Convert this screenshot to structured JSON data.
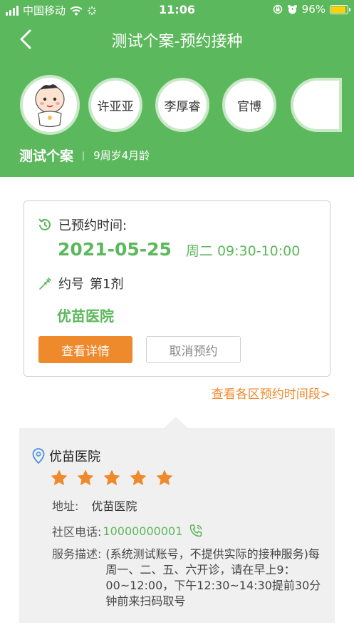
{
  "status_bar": {
    "carrier": "中国移动",
    "time": "11:06",
    "battery": "96%",
    "battery_level": 0.96
  },
  "nav": {
    "title": "测试个案-预约接种",
    "back_icon": "chevron-left-icon"
  },
  "profiles": [
    {
      "label": "许亚亚"
    },
    {
      "label": "李厚睿"
    },
    {
      "label": "官博"
    }
  ],
  "add_profile_icon": "plus-circle-icon",
  "child": {
    "name": "测试个案",
    "separator": "|",
    "age": "9周岁4月龄"
  },
  "appointment": {
    "time_label": "已预约时间:",
    "date": "2021-05-25",
    "weekday_time": "周二 09:30-10:00",
    "dose_label": "约号",
    "dose_value": "第1剂",
    "hospital": "优苗医院",
    "detail_button": "查看详情",
    "cancel_button": "取消预约"
  },
  "periods_link": "查看各区预约时间段>",
  "hospital_info": {
    "name": "优苗医院",
    "rating": 5,
    "address_label": "地址:",
    "address": "优苗医院",
    "phone_label": "社区电话:",
    "phone": "10000000001",
    "service_label": "服务描述:",
    "service_desc": "(系统测试账号，不提供实际的接种服务)每周一、二、五、六开诊，请在早上9：00~12:00，下午12:30~14:30提前30分钟前来扫码取号"
  },
  "colors": {
    "header_green": "#5cb85c",
    "accent_orange": "#ef8a2c",
    "star_orange": "#ef8a2c",
    "panel_gray": "#f0f0f0"
  }
}
